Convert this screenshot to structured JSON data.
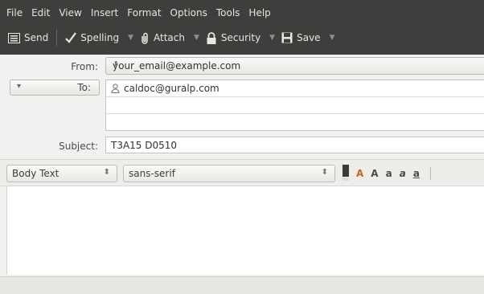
{
  "menu": [
    {
      "label": "File"
    },
    {
      "label": "Edit"
    },
    {
      "label": "View"
    },
    {
      "label": "Insert"
    },
    {
      "label": "Format"
    },
    {
      "label": "Options"
    },
    {
      "label": "Tools"
    },
    {
      "label": "Help"
    }
  ],
  "toolbar": {
    "send": "Send",
    "spelling": "Spelling",
    "attach": "Attach",
    "security": "Security",
    "save": "Save"
  },
  "header": {
    "from_label": "From:",
    "from_value": "your_email@example.com",
    "to_label": "To:",
    "to_value": "caldoc@guralp.com",
    "subject_label": "Subject:",
    "subject_value": "T3A15 D0510"
  },
  "format": {
    "paragraph_style": "Body Text",
    "font": "sans-serif"
  },
  "colors": {
    "dark_bar": "#3e3e3c",
    "accent": "#c9641c"
  }
}
